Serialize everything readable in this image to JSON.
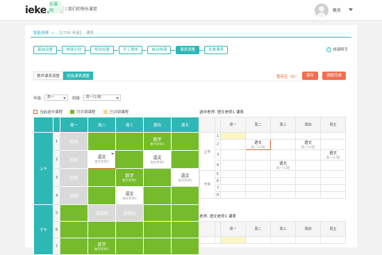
{
  "header": {
    "logo_text": "ieke",
    "logo_suffix": ".cn",
    "logo_badge": "乐课网",
    "slogan": "| 我们的快乐课堂",
    "user_name": "教务"
  },
  "breadcrumb": [
    "智能排课",
    ">",
    "【2709",
    "年级】",
    "课表"
  ],
  "steps": [
    "基础设置",
    "排课计划",
    "规则设置",
    "手工预排",
    "自动排课",
    "课表调整",
    "查看课表"
  ],
  "active_step": 5,
  "help_label": "排课帮手",
  "subtabs": [
    "教师课表调整",
    "班级课表调整"
  ],
  "active_subtab": 1,
  "temp_label": "暂存区（0）",
  "buttons": {
    "save": "保存",
    "done": "调整完成"
  },
  "filters": {
    "grade_label": "年级:",
    "grade_value": "高一",
    "class_label": "班级:",
    "class_value": "高一(1)班"
  },
  "legend": [
    "当前选中课程",
    "可对调课程",
    "已对调课程"
  ],
  "colors": {
    "accent": "#2db7b5",
    "green": "#75bb2b",
    "orange": "#e8602c",
    "yellow": "#fbd59b"
  },
  "main_table": {
    "days": [
      "周一",
      "周二",
      "周三",
      "周四",
      "周五"
    ],
    "periods": {
      "am": "上午",
      "pm": "下午"
    },
    "rows": [
      {
        "num": "1",
        "cells": [
          {
            "t": "gr",
            "a": "班级"
          },
          {
            "t": "g"
          },
          {
            "t": "g"
          },
          {
            "t": "g",
            "a": "数学",
            "b": "数学老师1"
          },
          {
            "t": "g"
          }
        ]
      },
      {
        "num": "2",
        "cells": [
          {
            "t": "gr",
            "a": "班级"
          },
          {
            "t": "sel",
            "a": "语文",
            "b": "语文老师1"
          },
          {
            "t": "g"
          },
          {
            "t": "w",
            "a": "语文",
            "b": "语文老师1"
          },
          {
            "t": "g"
          }
        ]
      },
      {
        "num": "3",
        "cells": [
          {
            "t": "gr",
            "a": "班级"
          },
          {
            "t": "g"
          },
          {
            "t": "g",
            "a": "数学",
            "b": "数学老师1"
          },
          {
            "t": "g"
          },
          {
            "t": "w",
            "a": "语文",
            "b": "语文老师1"
          }
        ]
      },
      {
        "num": "4",
        "cells": [
          {
            "t": "gr",
            "a": "班级"
          },
          {
            "t": "g"
          },
          {
            "t": "w",
            "a": "语文",
            "b": "语文老师1"
          },
          {
            "t": "g"
          },
          {
            "t": "g"
          }
        ]
      },
      {
        "num": "5",
        "cells": [
          {
            "t": "g"
          },
          {
            "t": "gr",
            "a": "选修班"
          },
          {
            "t": "gr",
            "a": "选修班"
          },
          {
            "t": "g"
          },
          {
            "t": "g"
          }
        ]
      },
      {
        "num": "6",
        "cells": [
          {
            "t": "g"
          },
          {
            "t": "g"
          },
          {
            "t": "g"
          },
          {
            "t": "g"
          },
          {
            "t": "g"
          }
        ]
      },
      {
        "num": "7",
        "cells": [
          {
            "t": "g"
          },
          {
            "t": "g",
            "a": "数学",
            "b": "数学老师1"
          },
          {
            "t": "g"
          },
          {
            "t": "g"
          },
          {
            "t": "g"
          }
        ]
      }
    ]
  },
  "right1": {
    "label": "选中老师:  语文老师1 课表",
    "days": [
      "周一",
      "周二",
      "周三",
      "周四",
      "周五"
    ],
    "periods": {
      "am": "上午",
      "pm": "下午"
    },
    "rows": [
      "1",
      "2",
      "3",
      "4",
      "5",
      "6",
      "7",
      "8"
    ],
    "entries": [
      {
        "row": 1,
        "col": 1,
        "a": "语文",
        "b": "高一(1)班",
        "box": true
      },
      {
        "row": 1,
        "col": 3,
        "a": "语文",
        "b": "高一(1)班"
      },
      {
        "row": 2,
        "col": 4,
        "a": "语文",
        "b": "高一(1)班"
      },
      {
        "row": 3,
        "col": 2,
        "a": "语文",
        "b": "高一(1)班"
      }
    ]
  },
  "right2": {
    "label": "老师:  语文老师1 课表",
    "days": [
      "周一",
      "周二",
      "周三",
      "周四",
      "周五"
    ]
  }
}
